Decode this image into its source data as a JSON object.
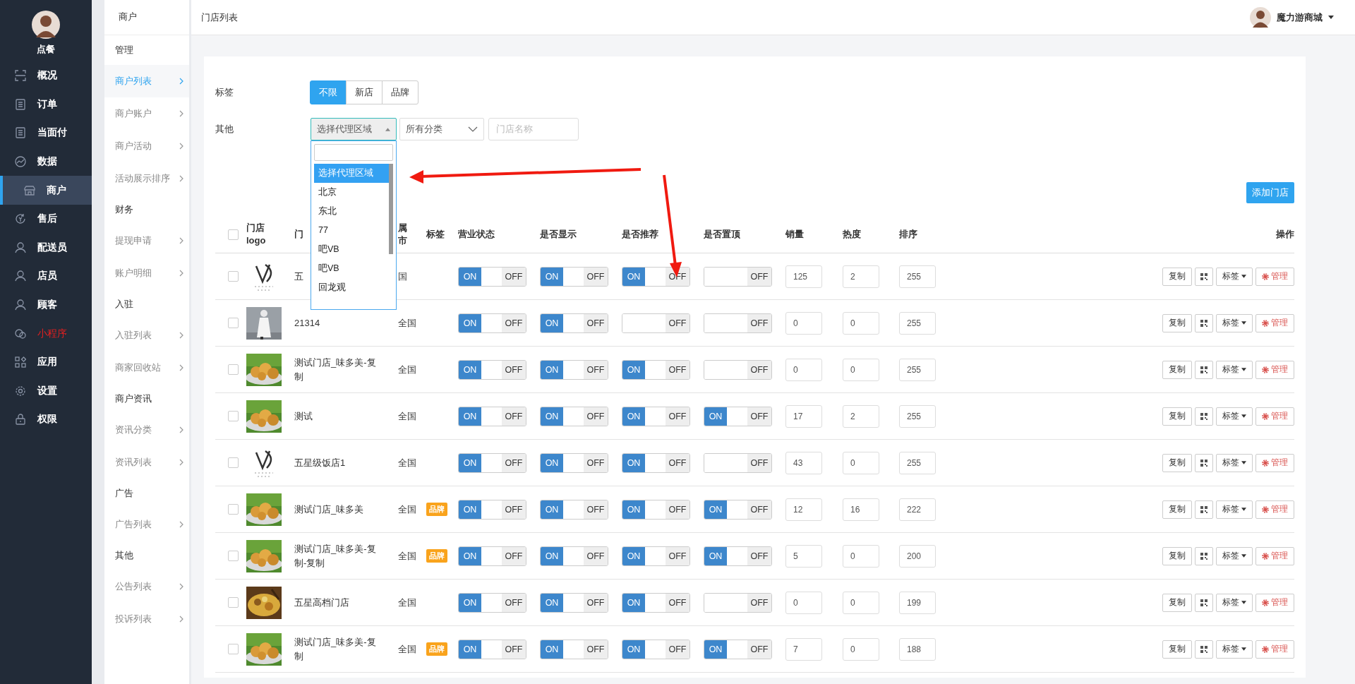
{
  "brand": {
    "name": "点餐"
  },
  "nav": [
    {
      "label": "概况",
      "selected": false,
      "alert": false
    },
    {
      "label": "订单",
      "selected": false,
      "alert": false
    },
    {
      "label": "当面付",
      "selected": false,
      "alert": false
    },
    {
      "label": "数据",
      "selected": false,
      "alert": false
    },
    {
      "label": "商户",
      "selected": true,
      "alert": false
    },
    {
      "label": "售后",
      "selected": false,
      "alert": false
    },
    {
      "label": "配送员",
      "selected": false,
      "alert": false
    },
    {
      "label": "店员",
      "selected": false,
      "alert": false
    },
    {
      "label": "顾客",
      "selected": false,
      "alert": false
    },
    {
      "label": "小程序",
      "selected": false,
      "alert": true
    },
    {
      "label": "应用",
      "selected": false,
      "alert": false
    },
    {
      "label": "设置",
      "selected": false,
      "alert": false
    },
    {
      "label": "权限",
      "selected": false,
      "alert": false
    }
  ],
  "subnav": {
    "title": "商户",
    "items": [
      {
        "kind": "group",
        "label": "管理"
      },
      {
        "kind": "link",
        "label": "商户列表",
        "selected": true
      },
      {
        "kind": "link",
        "label": "商户账户",
        "selected": false
      },
      {
        "kind": "link",
        "label": "商户活动",
        "selected": false
      },
      {
        "kind": "link",
        "label": "活动展示排序",
        "selected": false
      },
      {
        "kind": "group",
        "label": "财务"
      },
      {
        "kind": "link",
        "label": "提现申请",
        "selected": false
      },
      {
        "kind": "link",
        "label": "账户明细",
        "selected": false
      },
      {
        "kind": "group",
        "label": "入驻"
      },
      {
        "kind": "link",
        "label": "入驻列表",
        "selected": false
      },
      {
        "kind": "link",
        "label": "商家回收站",
        "selected": false
      },
      {
        "kind": "group",
        "label": "商户资讯"
      },
      {
        "kind": "link",
        "label": "资讯分类",
        "selected": false
      },
      {
        "kind": "link",
        "label": "资讯列表",
        "selected": false
      },
      {
        "kind": "group",
        "label": "广告"
      },
      {
        "kind": "link",
        "label": "广告列表",
        "selected": false
      },
      {
        "kind": "group",
        "label": "其他"
      },
      {
        "kind": "link",
        "label": "公告列表",
        "selected": false
      },
      {
        "kind": "link",
        "label": "投诉列表",
        "selected": false
      }
    ]
  },
  "page_title": "门店列表",
  "user": {
    "name": "魔力游商城"
  },
  "filters": {
    "tag_label": "标签",
    "tags": [
      {
        "label": "不限",
        "selected": true
      },
      {
        "label": "新店",
        "selected": false
      },
      {
        "label": "品牌",
        "selected": false
      }
    ],
    "other_label": "其他",
    "region_select": {
      "value": "选择代理区域",
      "open": true,
      "options": [
        {
          "label": "选择代理区域",
          "selected": true
        },
        {
          "label": "北京",
          "selected": false
        },
        {
          "label": "东北",
          "selected": false
        },
        {
          "label": "77",
          "selected": false
        },
        {
          "label": "吧VB",
          "selected": false
        },
        {
          "label": "吧VB",
          "selected": false
        },
        {
          "label": "回龙观",
          "selected": false
        }
      ]
    },
    "category_select": {
      "value": "所有分类"
    },
    "name_field": {
      "placeholder": "门店名称"
    }
  },
  "add_button": "添加门店",
  "table": {
    "checked": false,
    "columns": [
      "门店 logo",
      "门",
      "属市",
      "标签",
      "营业状态",
      "是否显示",
      "是否推荐",
      "是否置顶",
      "销量",
      "热度",
      "排序",
      "操作"
    ],
    "rows": [
      {
        "checked": false,
        "thumb": {
          "kind": "logo"
        },
        "name": "五",
        "city": "国",
        "switches": [
          {
            "on": true,
            "on_label": "ON",
            "off_label": "OFF"
          },
          {
            "on": true,
            "on_label": "ON",
            "off_label": "OFF"
          },
          {
            "on": true,
            "on_label": "ON",
            "off_label": "OFF"
          },
          {
            "on": false,
            "off_label": "OFF"
          }
        ],
        "sales": "125",
        "heat": "2",
        "sort": "255",
        "actions": [
          "复制",
          "标签",
          "管理"
        ]
      },
      {
        "checked": false,
        "thumb": {
          "kind": "picture"
        },
        "name": "21314",
        "city": "全国",
        "switches": [
          {
            "on": true,
            "on_label": "ON",
            "off_label": "OFF"
          },
          {
            "on": true,
            "on_label": "ON",
            "off_label": "OFF"
          },
          {
            "on": false,
            "off_label": "OFF"
          },
          {
            "on": false,
            "off_label": "OFF"
          }
        ],
        "sales": "0",
        "heat": "0",
        "sort": "255",
        "actions": [
          "复制",
          "标签",
          "管理"
        ]
      },
      {
        "checked": false,
        "thumb": {
          "kind": "picture"
        },
        "name": "测试门店_味多美-复制",
        "city": "全国",
        "switches": [
          {
            "on": true,
            "on_label": "ON",
            "off_label": "OFF"
          },
          {
            "on": true,
            "on_label": "ON",
            "off_label": "OFF"
          },
          {
            "on": true,
            "on_label": "ON",
            "off_label": "OFF"
          },
          {
            "on": false,
            "off_label": "OFF"
          }
        ],
        "sales": "0",
        "heat": "0",
        "sort": "255",
        "actions": [
          "复制",
          "标签",
          "管理"
        ]
      },
      {
        "checked": false,
        "thumb": {
          "kind": "picture"
        },
        "name": "测试",
        "city": "全国",
        "switches": [
          {
            "on": true,
            "on_label": "ON",
            "off_label": "OFF"
          },
          {
            "on": true,
            "on_label": "ON",
            "off_label": "OFF"
          },
          {
            "on": true,
            "on_label": "ON",
            "off_label": "OFF"
          },
          {
            "on": true,
            "on_label": "ON",
            "off_label": "OFF"
          }
        ],
        "sales": "17",
        "heat": "2",
        "sort": "255",
        "actions": [
          "复制",
          "标签",
          "管理"
        ]
      },
      {
        "checked": false,
        "thumb": {
          "kind": "logo"
        },
        "name": "五星级饭店1",
        "city": "全国",
        "switches": [
          {
            "on": true,
            "on_label": "ON",
            "off_label": "OFF"
          },
          {
            "on": true,
            "on_label": "ON",
            "off_label": "OFF"
          },
          {
            "on": true,
            "on_label": "ON",
            "off_label": "OFF"
          },
          {
            "on": false,
            "off_label": "OFF"
          }
        ],
        "sales": "43",
        "heat": "0",
        "sort": "255",
        "actions": [
          "复制",
          "标签",
          "管理"
        ]
      },
      {
        "checked": false,
        "thumb": {
          "kind": "picture"
        },
        "name": "测试门店_味多美",
        "city": "全国",
        "tag": "品牌",
        "switches": [
          {
            "on": true,
            "on_label": "ON",
            "off_label": "OFF"
          },
          {
            "on": true,
            "on_label": "ON",
            "off_label": "OFF"
          },
          {
            "on": true,
            "on_label": "ON",
            "off_label": "OFF"
          },
          {
            "on": true,
            "on_label": "ON",
            "off_label": "OFF"
          }
        ],
        "sales": "12",
        "heat": "16",
        "sort": "222",
        "actions": [
          "复制",
          "标签",
          "管理"
        ]
      },
      {
        "checked": false,
        "thumb": {
          "kind": "picture"
        },
        "name": "测试门店_味多美-复制-复制",
        "city": "全国",
        "tag": "品牌",
        "switches": [
          {
            "on": true,
            "on_label": "ON",
            "off_label": "OFF"
          },
          {
            "on": true,
            "on_label": "ON",
            "off_label": "OFF"
          },
          {
            "on": true,
            "on_label": "ON",
            "off_label": "OFF"
          },
          {
            "on": true,
            "on_label": "ON",
            "off_label": "OFF"
          }
        ],
        "sales": "5",
        "heat": "0",
        "sort": "200",
        "actions": [
          "复制",
          "标签",
          "管理"
        ]
      },
      {
        "checked": false,
        "thumb": {
          "kind": "picture"
        },
        "name": "五星高档门店",
        "city": "全国",
        "switches": [
          {
            "on": true,
            "on_label": "ON",
            "off_label": "OFF"
          },
          {
            "on": true,
            "on_label": "ON",
            "off_label": "OFF"
          },
          {
            "on": true,
            "on_label": "ON",
            "off_label": "OFF"
          },
          {
            "on": false,
            "off_label": "OFF"
          }
        ],
        "sales": "0",
        "heat": "0",
        "sort": "199",
        "actions": [
          "复制",
          "标签",
          "管理"
        ]
      },
      {
        "checked": false,
        "thumb": {
          "kind": "picture"
        },
        "name": "测试门店_味多美-复制",
        "city": "全国",
        "tag": "品牌",
        "switches": [
          {
            "on": true,
            "on_label": "ON",
            "off_label": "OFF"
          },
          {
            "on": true,
            "on_label": "ON",
            "off_label": "OFF"
          },
          {
            "on": true,
            "on_label": "ON",
            "off_label": "OFF"
          },
          {
            "on": true,
            "on_label": "ON",
            "off_label": "OFF"
          }
        ],
        "sales": "7",
        "heat": "0",
        "sort": "188",
        "actions": [
          "复制",
          "标签",
          "管理"
        ]
      }
    ]
  }
}
